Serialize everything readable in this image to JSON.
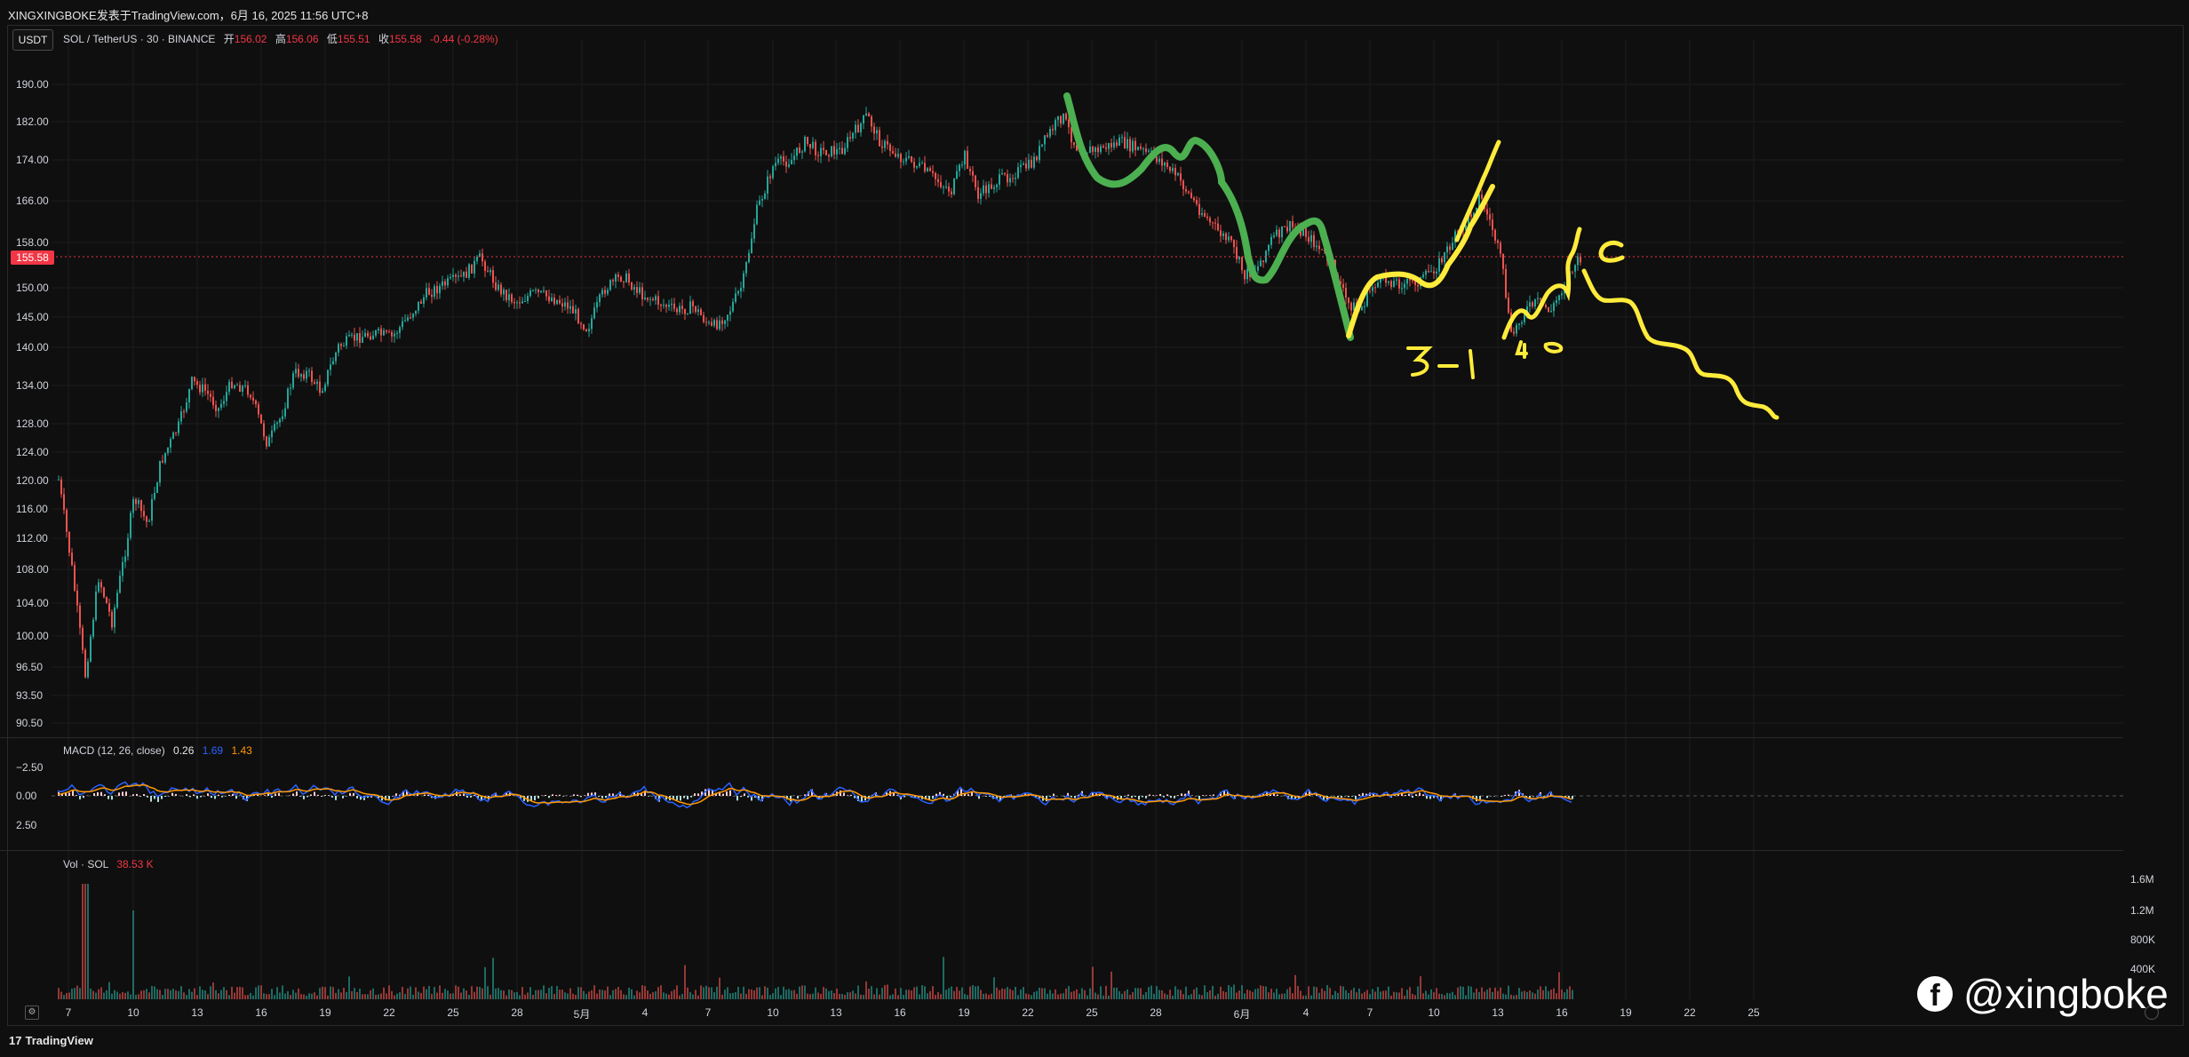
{
  "header": {
    "title": "XINGXINGBOKE发表于TradingView.com，6月 16, 2025 11:56 UTC+8"
  },
  "toolbar": {
    "currency_button": "USDT"
  },
  "legend": {
    "symbol": "SOL / TetherUS · 30 · BINANCE",
    "open_label": "开",
    "open": "156.02",
    "high_label": "高",
    "high": "156.06",
    "low_label": "低",
    "low": "155.51",
    "close_label": "收",
    "close": "155.58",
    "change": "-0.44 (-0.28%)"
  },
  "current_price": "155.58",
  "price_axis": [
    "190.00",
    "182.00",
    "174.00",
    "166.00",
    "158.00",
    "150.00",
    "145.00",
    "140.00",
    "134.00",
    "128.00",
    "124.00",
    "120.00",
    "116.00",
    "112.00",
    "108.00",
    "104.00",
    "100.00",
    "96.50",
    "93.50",
    "90.50"
  ],
  "macd": {
    "label": "MACD (12, 26, close)",
    "hist": "0.26",
    "macd": "1.69",
    "signal": "1.43",
    "axis": [
      "−2.50",
      "0.00",
      "2.50"
    ]
  },
  "volume": {
    "label": "Vol · SOL",
    "value": "38.53 K",
    "axis": [
      "1.6M",
      "1.2M",
      "800K",
      "400K"
    ]
  },
  "time_axis": [
    "7",
    "10",
    "13",
    "16",
    "19",
    "22",
    "25",
    "28",
    "5月",
    "4",
    "7",
    "10",
    "13",
    "16",
    "19",
    "22",
    "25",
    "28",
    "6月",
    "4",
    "7",
    "10",
    "13",
    "16",
    "19",
    "22",
    "25"
  ],
  "annotations": {
    "count_label": "3-1",
    "small_label": "4",
    "c_label": "c"
  },
  "footer": {
    "brand": "TradingView"
  },
  "watermark": {
    "handle": "@xingboke"
  },
  "colors": {
    "background": "#0f0f0f",
    "up": "#26a69a",
    "down": "#ef5350",
    "price_line": "#f23645",
    "macd_line": "#2962ff",
    "signal_line": "#ff9800",
    "drawing_green": "#4caf50",
    "drawing_yellow": "#ffeb3b"
  }
}
